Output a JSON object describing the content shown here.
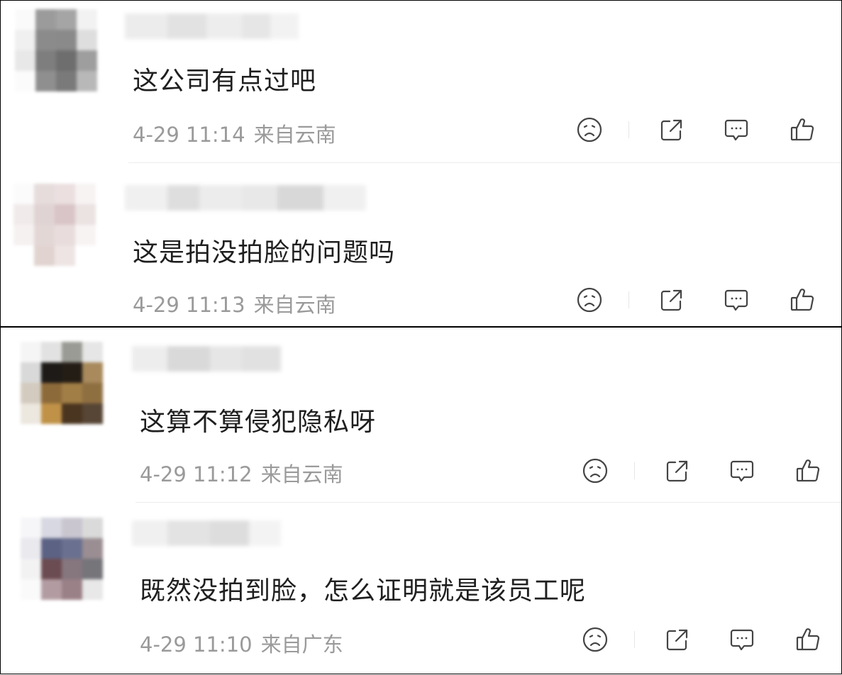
{
  "comments": [
    {
      "text": "这公司有点过吧",
      "time": "4-29 11:14",
      "location": "来自云南"
    },
    {
      "text": "这是拍没拍脸的问题吗",
      "time": "4-29 11:13",
      "location": "来自云南"
    },
    {
      "text": "这算不算侵犯隐私呀",
      "time": "4-29 11:12",
      "location": "来自云南"
    },
    {
      "text": "既然没拍到脸，怎么证明就是该员工呢",
      "time": "4-29 11:10",
      "location": "来自广东"
    }
  ],
  "icons": {
    "dislike": "sad-face-icon",
    "share": "share-icon",
    "comment": "comment-bubble-icon",
    "like": "thumbs-up-icon"
  },
  "colors": {
    "text": "#1f1f1f",
    "meta": "#9a9a9a",
    "icon": "#444444",
    "divider": "#ececec"
  }
}
